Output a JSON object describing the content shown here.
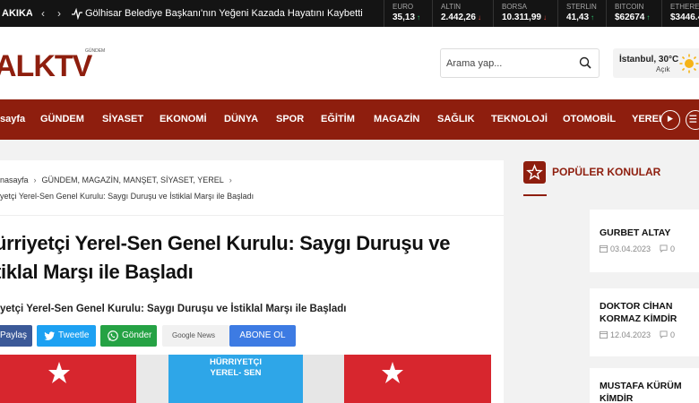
{
  "ticker": {
    "label": "AKIKA",
    "prev_icon": "chevron-left-icon",
    "next_icon": "chevron-right-icon",
    "headline": "Gölhisar Belediye Başkanı'nın Yeğeni Kazada Hayatını Kaybetti",
    "markets": [
      {
        "name": "EURO",
        "value": "35,13",
        "trend": "up"
      },
      {
        "name": "ALTIN",
        "value": "2.442,26",
        "trend": "down"
      },
      {
        "name": "BORSA",
        "value": "10.311,99",
        "trend": "down"
      },
      {
        "name": "STERLIN",
        "value": "41,43",
        "trend": "up"
      },
      {
        "name": "BITCOIN",
        "value": "$62674",
        "trend": "up"
      },
      {
        "name": "ETHEREUM",
        "value": "$3446.4",
        "trend": "up"
      }
    ]
  },
  "header": {
    "logo_text": "ALKTV",
    "logo_tag": "GÜNDEM",
    "search_placeholder": "Arama yap...",
    "weather_city": "İstanbul, 30°C",
    "weather_condition": "Açık"
  },
  "nav": {
    "items": [
      "sayfa",
      "GÜNDEM",
      "SİYASET",
      "EKONOMİ",
      "DÜNYA",
      "SPOR",
      "EĞİTİM",
      "MAGAZİN",
      "SAĞLIK",
      "TEKNOLOJİ",
      "OTOMOBİL",
      "YEREL"
    ]
  },
  "article": {
    "breadcrumb_home": "nasayfa",
    "breadcrumb_categories": "GÜNDEM, MAGAZİN, MANŞET, SİYASET, YEREL",
    "breadcrumb_current": "yetçi Yerel-Sen Genel Kurulu: Saygı Duruşu ve İstiklal Marşı ile Başladı",
    "title_line1": "ürriyetçi Yerel-Sen Genel Kurulu: Saygı Duruşu ve",
    "title_line2": "tiklal Marşı ile Başladı",
    "subtitle": "yetçi Yerel-Sen Genel Kurulu: Saygı Duruşu ve İstiklal Marşı ile Başladı",
    "share": {
      "facebook": "Paylaş",
      "twitter": "Tweetle",
      "whatsapp": "Gönder",
      "google_news": "Google News",
      "subscribe": "ABONE OL"
    },
    "photo_text_1": "HÜRRIYETÇI",
    "photo_text_2": "YEREL- SEN"
  },
  "sidebar": {
    "popular_title": "POPÜLER KONULAR",
    "cards": [
      {
        "title": "GURBET ALTAY",
        "date": "03.04.2023",
        "comments": "0"
      },
      {
        "title": "DOKTOR CİHAN KORMAZ KİMDİR",
        "date": "12.04.2023",
        "comments": "0"
      },
      {
        "title": "MUSTAFA KÜRÜM KİMDİR",
        "date": "",
        "comments": ""
      }
    ]
  },
  "colors": {
    "brand": "#8e1e0e",
    "facebook": "#3b5998",
    "twitter": "#1da1f2",
    "whatsapp": "#25a244",
    "subscribe": "#3d7be3"
  }
}
